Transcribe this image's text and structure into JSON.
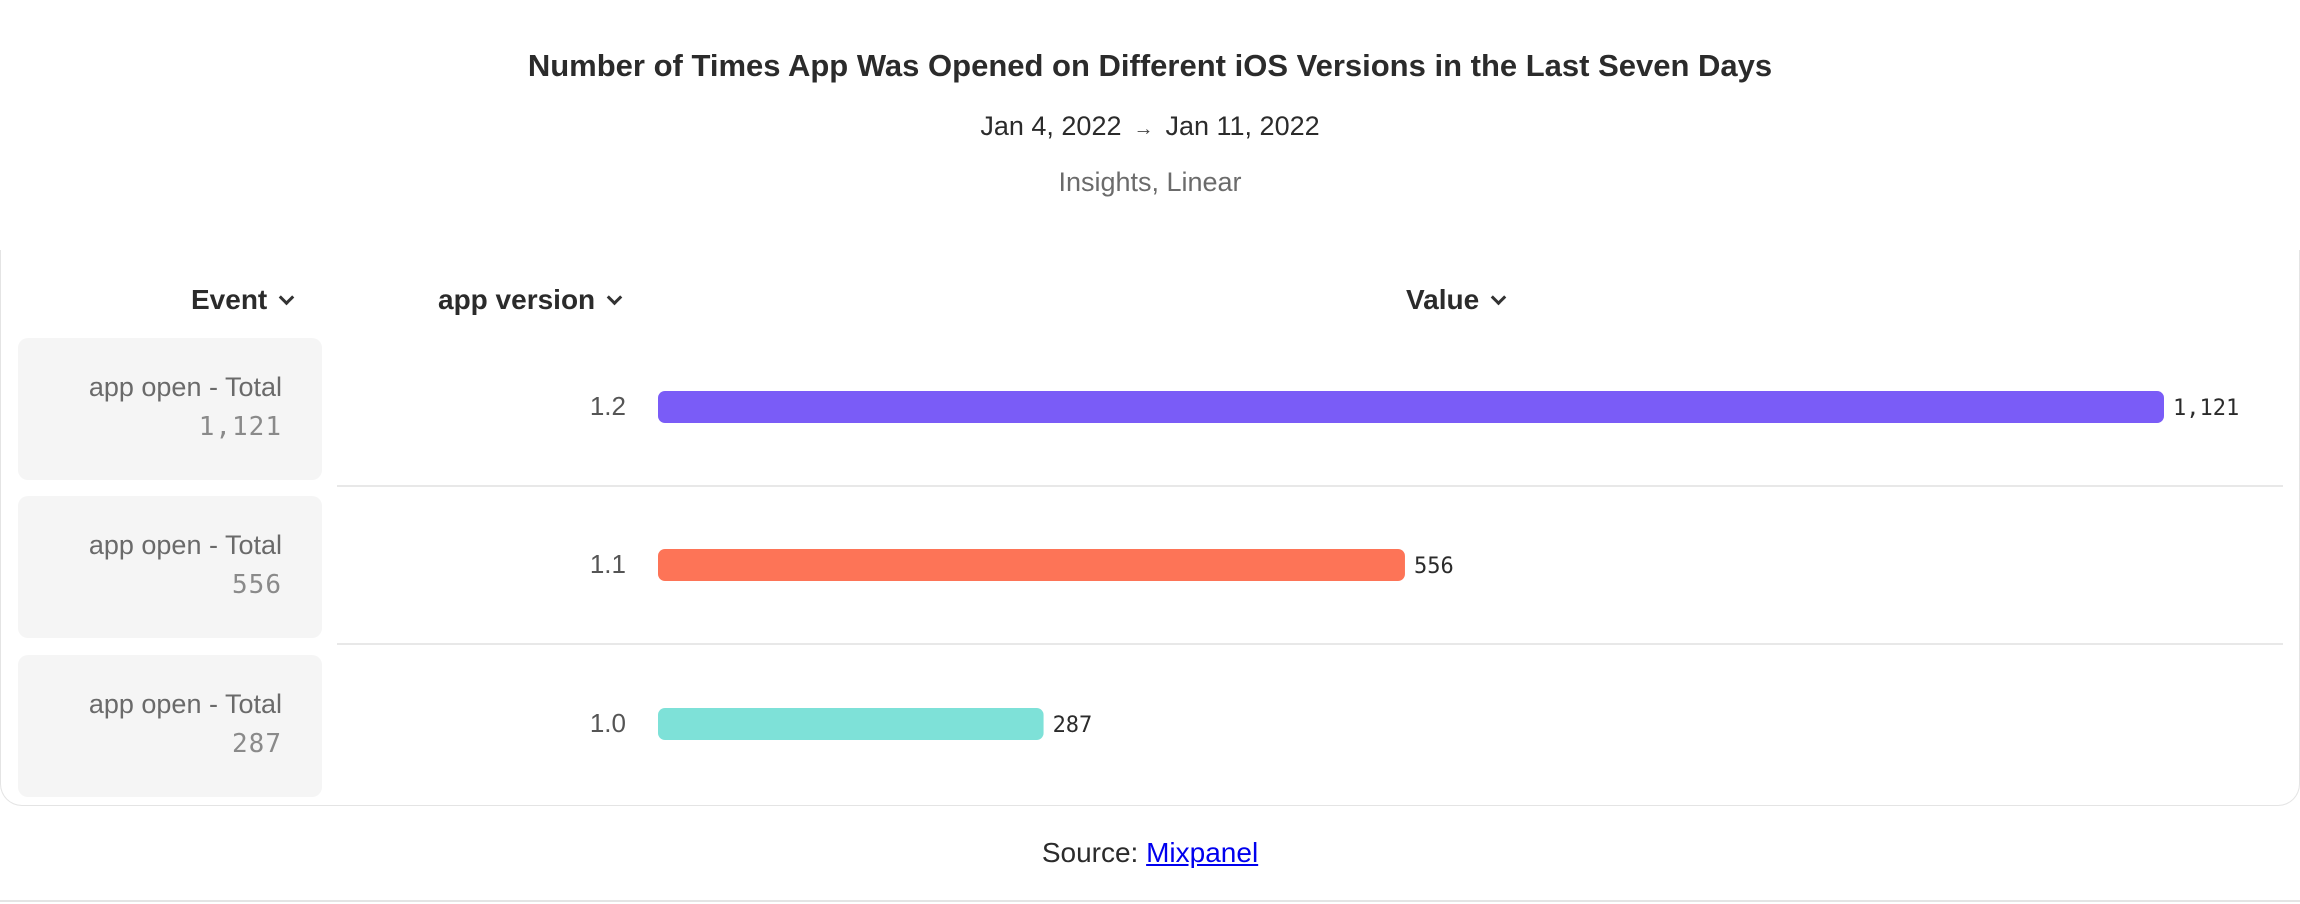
{
  "header": {
    "title": "Number of Times App Was Opened on Different iOS Versions in the Last Seven Days",
    "date_start": "Jan 4, 2022",
    "date_arrow": "→",
    "date_end": "Jan 11, 2022",
    "subtitle": "Insights, Linear"
  },
  "columns": {
    "event": "Event",
    "version": "app version",
    "value": "Value"
  },
  "rows": [
    {
      "event": "app open - Total",
      "event_value": "1,121",
      "version": "1.2",
      "value_label": "1,121"
    },
    {
      "event": "app open - Total",
      "event_value": "556",
      "version": "1.1",
      "value_label": "556"
    },
    {
      "event": "app open - Total",
      "event_value": "287",
      "version": "1.0",
      "value_label": "287"
    }
  ],
  "footer": {
    "source_prefix": "Source:",
    "source_link": "Mixpanel"
  },
  "chart_data": {
    "type": "bar",
    "orientation": "horizontal",
    "title": "Number of Times App Was Opened on Different iOS Versions in the Last Seven Days",
    "subtitle": "Insights, Linear",
    "xlabel": "Value",
    "ylabel": "app version",
    "categories": [
      "1.2",
      "1.1",
      "1.0"
    ],
    "values": [
      1121,
      556,
      287
    ],
    "colors": [
      "#7a5cf7",
      "#fd7457",
      "#7ee1d8"
    ],
    "xlim": [
      0,
      1121
    ],
    "grid": false,
    "legend": "none"
  }
}
